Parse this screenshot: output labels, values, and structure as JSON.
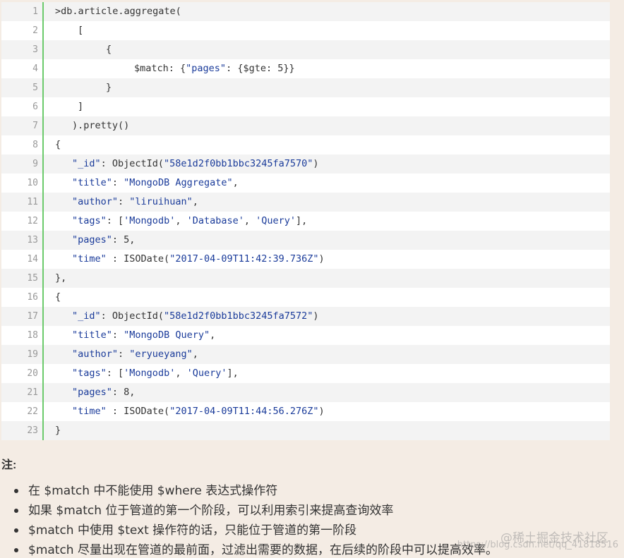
{
  "code": {
    "lines": [
      {
        "num": "1",
        "indent": 0,
        "tokens": [
          {
            "t": ">db.article.aggregate(",
            "s": false
          }
        ]
      },
      {
        "num": "2",
        "indent": 4,
        "tokens": [
          {
            "t": "[",
            "s": false
          }
        ]
      },
      {
        "num": "3",
        "indent": 9,
        "tokens": [
          {
            "t": "{",
            "s": false
          }
        ]
      },
      {
        "num": "4",
        "indent": 14,
        "tokens": [
          {
            "t": "$match: {",
            "s": false
          },
          {
            "t": "\"pages\"",
            "s": true
          },
          {
            "t": ": {$gte: 5}}",
            "s": false
          }
        ]
      },
      {
        "num": "5",
        "indent": 9,
        "tokens": [
          {
            "t": "}",
            "s": false
          }
        ]
      },
      {
        "num": "6",
        "indent": 4,
        "tokens": [
          {
            "t": "]",
            "s": false
          }
        ]
      },
      {
        "num": "7",
        "indent": 3,
        "tokens": [
          {
            "t": ").pretty()",
            "s": false
          }
        ]
      },
      {
        "num": "8",
        "indent": 0,
        "tokens": [
          {
            "t": "{",
            "s": false
          }
        ]
      },
      {
        "num": "9",
        "indent": 3,
        "tokens": [
          {
            "t": "\"_id\"",
            "s": true
          },
          {
            "t": ": ObjectId(",
            "s": false
          },
          {
            "t": "\"58e1d2f0bb1bbc3245fa7570\"",
            "s": true
          },
          {
            "t": ")",
            "s": false
          }
        ]
      },
      {
        "num": "10",
        "indent": 3,
        "tokens": [
          {
            "t": "\"title\"",
            "s": true
          },
          {
            "t": ": ",
            "s": false
          },
          {
            "t": "\"MongoDB Aggregate\"",
            "s": true
          },
          {
            "t": ",",
            "s": false
          }
        ]
      },
      {
        "num": "11",
        "indent": 3,
        "tokens": [
          {
            "t": "\"author\"",
            "s": true
          },
          {
            "t": ": ",
            "s": false
          },
          {
            "t": "\"liruihuan\"",
            "s": true
          },
          {
            "t": ",",
            "s": false
          }
        ]
      },
      {
        "num": "12",
        "indent": 3,
        "tokens": [
          {
            "t": "\"tags\"",
            "s": true
          },
          {
            "t": ": [",
            "s": false
          },
          {
            "t": "'Mongodb'",
            "s": true
          },
          {
            "t": ", ",
            "s": false
          },
          {
            "t": "'Database'",
            "s": true
          },
          {
            "t": ", ",
            "s": false
          },
          {
            "t": "'Query'",
            "s": true
          },
          {
            "t": "],",
            "s": false
          }
        ]
      },
      {
        "num": "13",
        "indent": 3,
        "tokens": [
          {
            "t": "\"pages\"",
            "s": true
          },
          {
            "t": ": 5,",
            "s": false
          }
        ]
      },
      {
        "num": "14",
        "indent": 3,
        "tokens": [
          {
            "t": "\"time\"",
            "s": true
          },
          {
            "t": " : ISODate(",
            "s": false
          },
          {
            "t": "\"2017-04-09T11:42:39.736Z\"",
            "s": true
          },
          {
            "t": ")",
            "s": false
          }
        ]
      },
      {
        "num": "15",
        "indent": 0,
        "tokens": [
          {
            "t": "},",
            "s": false
          }
        ]
      },
      {
        "num": "16",
        "indent": 0,
        "tokens": [
          {
            "t": "{",
            "s": false
          }
        ]
      },
      {
        "num": "17",
        "indent": 3,
        "tokens": [
          {
            "t": "\"_id\"",
            "s": true
          },
          {
            "t": ": ObjectId(",
            "s": false
          },
          {
            "t": "\"58e1d2f0bb1bbc3245fa7572\"",
            "s": true
          },
          {
            "t": ")",
            "s": false
          }
        ]
      },
      {
        "num": "18",
        "indent": 3,
        "tokens": [
          {
            "t": "\"title\"",
            "s": true
          },
          {
            "t": ": ",
            "s": false
          },
          {
            "t": "\"MongoDB Query\"",
            "s": true
          },
          {
            "t": ",",
            "s": false
          }
        ]
      },
      {
        "num": "19",
        "indent": 3,
        "tokens": [
          {
            "t": "\"author\"",
            "s": true
          },
          {
            "t": ": ",
            "s": false
          },
          {
            "t": "\"eryueyang\"",
            "s": true
          },
          {
            "t": ",",
            "s": false
          }
        ]
      },
      {
        "num": "20",
        "indent": 3,
        "tokens": [
          {
            "t": "\"tags\"",
            "s": true
          },
          {
            "t": ": [",
            "s": false
          },
          {
            "t": "'Mongodb'",
            "s": true
          },
          {
            "t": ", ",
            "s": false
          },
          {
            "t": "'Query'",
            "s": true
          },
          {
            "t": "],",
            "s": false
          }
        ]
      },
      {
        "num": "21",
        "indent": 3,
        "tokens": [
          {
            "t": "\"pages\"",
            "s": true
          },
          {
            "t": ": 8,",
            "s": false
          }
        ]
      },
      {
        "num": "22",
        "indent": 3,
        "tokens": [
          {
            "t": "\"time\"",
            "s": true
          },
          {
            "t": " : ISODate(",
            "s": false
          },
          {
            "t": "\"2017-04-09T11:44:56.276Z\"",
            "s": true
          },
          {
            "t": ")",
            "s": false
          }
        ]
      },
      {
        "num": "23",
        "indent": 0,
        "tokens": [
          {
            "t": "}",
            "s": false
          }
        ]
      }
    ]
  },
  "notes": {
    "title": "注:",
    "items": [
      "在 $match 中不能使用 $where 表达式操作符",
      "如果 $match 位于管道的第一个阶段，可以利用索引来提高查询效率",
      "$match 中使用 $text 操作符的话，只能位于管道的第一阶段",
      "$match 尽量出现在管道的最前面，过滤出需要的数据，在后续的阶段中可以提高效率。"
    ]
  },
  "watermark": {
    "text": "@稀土掘金技术社区",
    "sub": "https://blog.csdn.net/qq_41818516"
  },
  "colors": {
    "string": "#1a3b9a",
    "gutter_border": "#6cca6c",
    "page_bg": "#f4ece4"
  }
}
